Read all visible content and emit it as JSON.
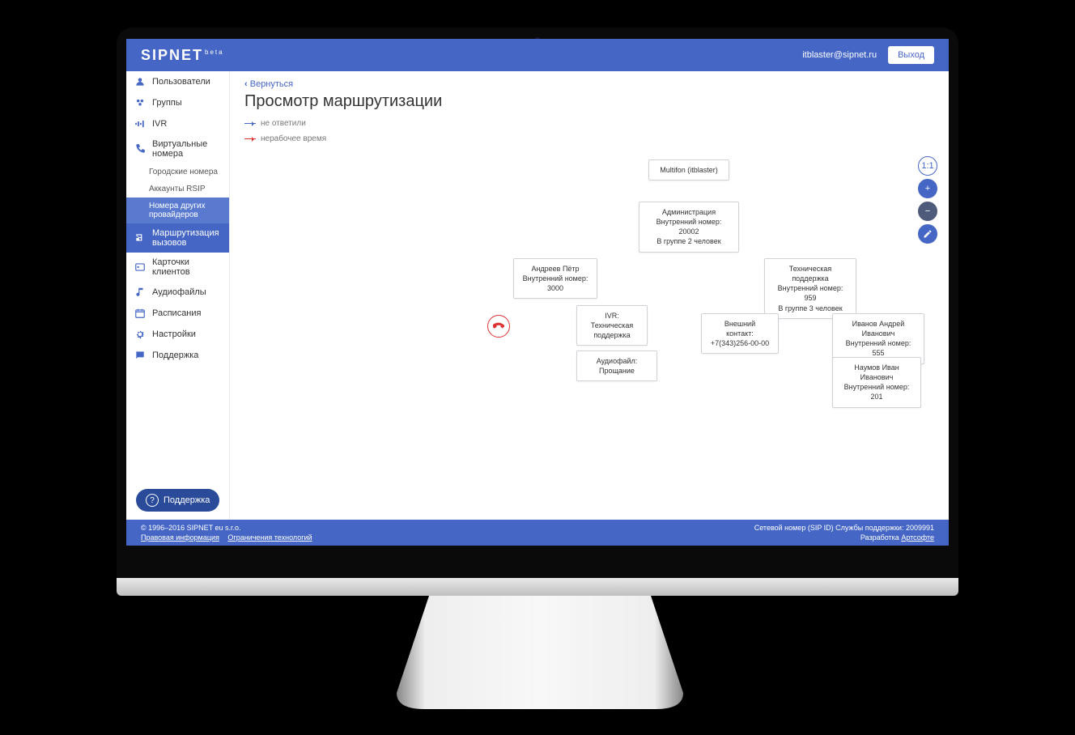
{
  "header": {
    "brand": "SIPNET",
    "brand_sup": "beta",
    "email": "itblaster@sipnet.ru",
    "logout": "Выход"
  },
  "sidebar": {
    "items": [
      {
        "label": "Пользователи",
        "icon": "users"
      },
      {
        "label": "Группы",
        "icon": "groups"
      },
      {
        "label": "IVR",
        "icon": "ivr"
      },
      {
        "label": "Виртуальные номера",
        "icon": "phone",
        "expanded": true,
        "subs": [
          {
            "label": "Городские номера"
          },
          {
            "label": "Аккаунты RSIP"
          },
          {
            "label": "Номера других провайдеров",
            "selected": true
          }
        ]
      },
      {
        "label": "Маршрутизация вызовов",
        "icon": "route",
        "active": true
      },
      {
        "label": "Карточки клиентов",
        "icon": "cards"
      },
      {
        "label": "Аудиофайлы",
        "icon": "audio"
      },
      {
        "label": "Расписания",
        "icon": "schedule"
      },
      {
        "label": "Настройки",
        "icon": "settings"
      },
      {
        "label": "Поддержка",
        "icon": "support"
      }
    ]
  },
  "content": {
    "back": "Вернуться",
    "title": "Просмотр маршрутизации",
    "legend": {
      "blue": "не ответили",
      "red": "нерабочее время"
    }
  },
  "nodes": {
    "root": {
      "title": "Multifon (itblaster)"
    },
    "admin": {
      "title": "Администрация",
      "l1": "Внутренний номер: 20002",
      "l2": "В группе 2 человек"
    },
    "andreev": {
      "title": "Андреев Пётр",
      "l1": "Внутренний номер: 3000"
    },
    "ivr": {
      "title": "IVR: Техническая поддержка"
    },
    "audio": {
      "title": "Аудиофайл: Прощание"
    },
    "tech": {
      "title": "Техническая поддержка",
      "l1": "Внутренний номер: 959",
      "l2": "В группе 3 человек"
    },
    "ext": {
      "title": "Внешний контакт:",
      "l1": "+7(343)256-00-00"
    },
    "ivanov": {
      "title": "Иванов Андрей Иванович",
      "l1": "Внутренний номер: 555"
    },
    "naumov": {
      "title": "Наумов Иван Иванович",
      "l1": "Внутренний номер: 201"
    }
  },
  "tools": {
    "fit": "1:1",
    "zoomin": "+",
    "zoomout": "−"
  },
  "footer": {
    "copyright": "© 1996–2016 SIPNET eu s.r.o.",
    "legal": "Правовая информация",
    "tech": "Ограничения технологий",
    "support_id": "Сетевой номер (SIP ID) Службы поддержки: 2009991",
    "dev_prefix": "Разработка ",
    "dev_link": "Артсофте"
  },
  "widget": {
    "label": "Поддержка"
  }
}
